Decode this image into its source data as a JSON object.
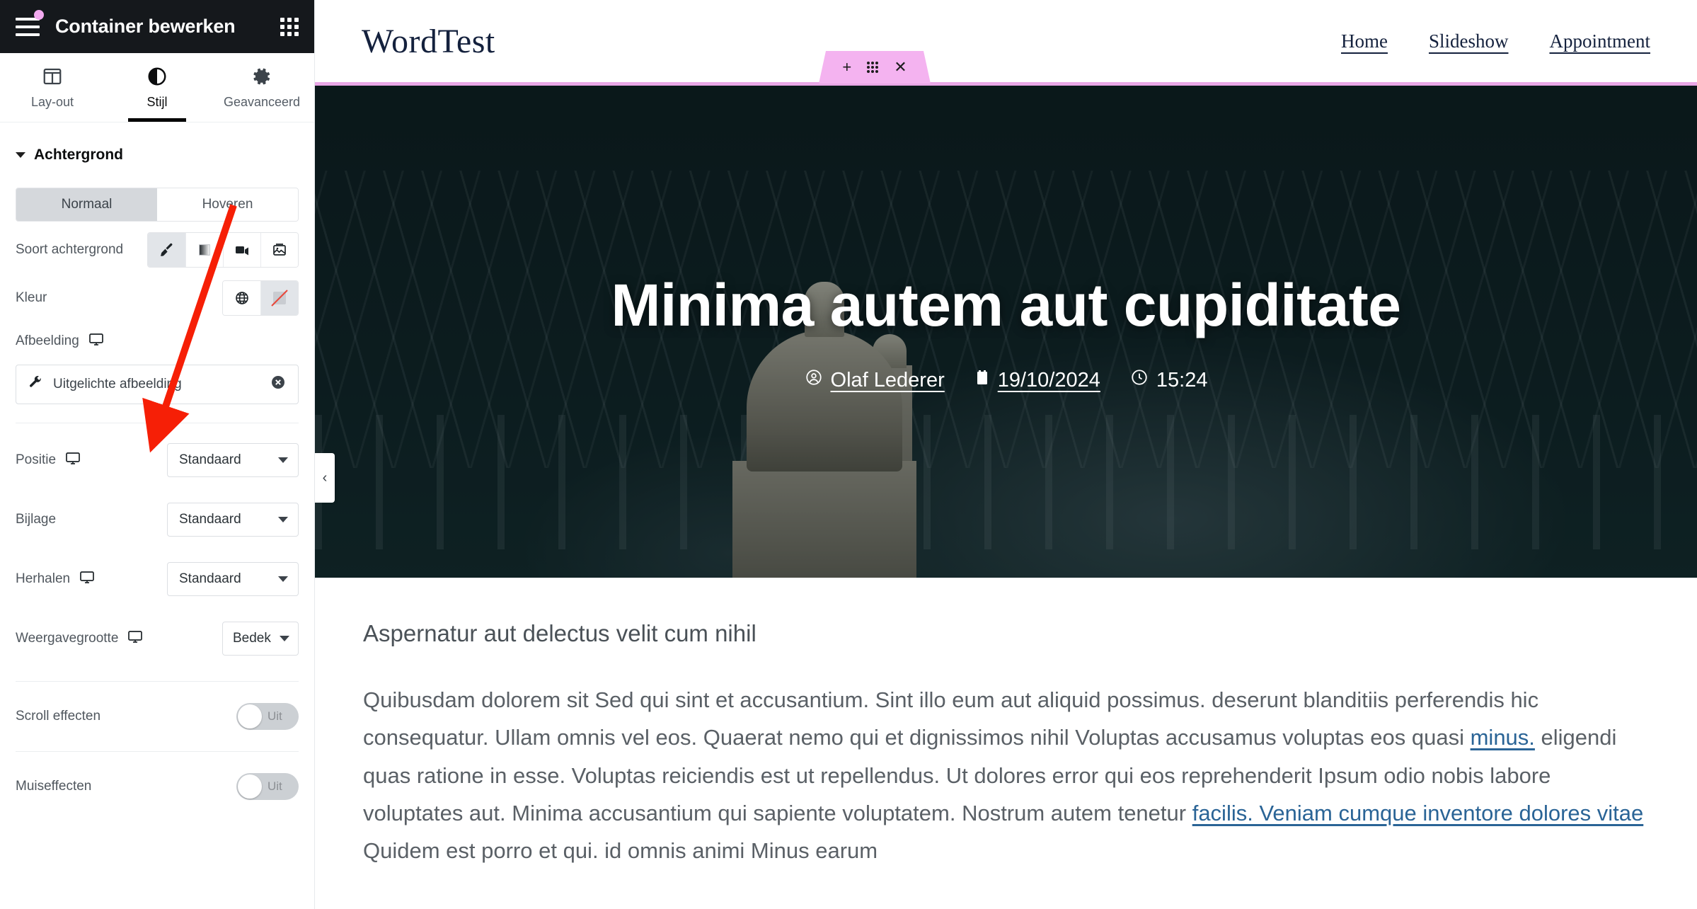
{
  "panel": {
    "title": "Container bewerken",
    "menu_icon": "hamburger-icon",
    "apps_icon": "apps-grid-icon",
    "tabs": [
      {
        "label": "Lay-out",
        "icon": "columns-layout-icon",
        "active": false
      },
      {
        "label": "Stijl",
        "icon": "contrast-circle-icon",
        "active": true
      },
      {
        "label": "Geavanceerd",
        "icon": "gear-icon",
        "active": false
      }
    ],
    "section": {
      "title": "Achtergrond",
      "expanded": true
    },
    "state_tabs": {
      "normal": "Normaal",
      "hover": "Hoveren",
      "selected": "Normaal"
    },
    "background_type": {
      "label": "Soort achtergrond",
      "options": [
        "brush-classic-icon",
        "gradient-icon",
        "video-icon",
        "slideshow-icon"
      ],
      "selected_index": 0
    },
    "color": {
      "label": "Kleur",
      "options": [
        "globe-icon",
        "no-color-icon"
      ],
      "selected_index": 1
    },
    "image": {
      "label": "Afbeelding",
      "device_icon": "desktop-icon",
      "field_icon": "wrench-icon",
      "value": "Uitgelichte afbeelding",
      "clear_icon": "clear-circle-icon"
    },
    "fields": [
      {
        "label": "Positie",
        "device_icon": "desktop-icon",
        "value": "Standaard",
        "wide": true
      },
      {
        "label": "Bijlage",
        "device_icon": null,
        "value": "Standaard",
        "wide": true
      },
      {
        "label": "Herhalen",
        "device_icon": "desktop-icon",
        "value": "Standaard",
        "wide": true
      },
      {
        "label": "Weergavegrootte",
        "device_icon": "desktop-icon",
        "value": "Bedek",
        "wide": false
      }
    ],
    "toggles": [
      {
        "label": "Scroll effecten",
        "state": "Uit",
        "on": false
      },
      {
        "label": "Muiseffecten",
        "state": "Uit",
        "on": false
      }
    ],
    "collapse_icon": "chevron-left-icon"
  },
  "preview": {
    "logo": "WordTest",
    "nav": [
      {
        "label": "Home"
      },
      {
        "label": "Slideshow"
      },
      {
        "label": "Appointment"
      }
    ],
    "editbar": {
      "add_icon": "plus-icon",
      "drag_icon": "drag-dots-icon",
      "close_icon": "close-x-icon"
    },
    "hero": {
      "title": "Minima autem aut cupiditate",
      "meta": [
        {
          "icon": "author-avatar-icon",
          "text": "Olaf Lederer",
          "underline": true
        },
        {
          "icon": "calendar-icon",
          "text": "19/10/2024",
          "underline": true
        },
        {
          "icon": "clock-icon",
          "text": "15:24",
          "underline": false
        }
      ]
    },
    "article": {
      "heading": "Aspernatur aut delectus velit cum nihil",
      "paragraph_parts": [
        {
          "type": "text",
          "value": "Quibusdam dolorem sit Sed qui sint et accusantium. Sint illo eum aut aliquid possimus. deserunt blanditiis perferendis hic consequatur. Ullam omnis vel eos. Quaerat nemo qui et dignissimos nihil Voluptas accusamus voluptas eos quasi "
        },
        {
          "type": "link",
          "value": "minus."
        },
        {
          "type": "text",
          "value": " eligendi quas ratione in esse. Voluptas reiciendis est ut repellendus. Ut dolores error qui eos reprehenderit Ipsum odio nobis labore voluptates aut. Minima accusantium qui sapiente voluptatem. Nostrum autem tenetur "
        },
        {
          "type": "link",
          "value": "facilis. Veniam cumque inventore dolores vitae"
        },
        {
          "type": "text",
          "value": " Quidem est porro et qui. id omnis animi Minus earum"
        }
      ]
    }
  },
  "annotation": {
    "arrow_color": "#f61f06"
  },
  "colors": {
    "panel_header_bg": "#15181c",
    "accent_pink": "#f2a9ef",
    "hero_border": "#e9a7e6",
    "link_blue": "#2a6496"
  }
}
